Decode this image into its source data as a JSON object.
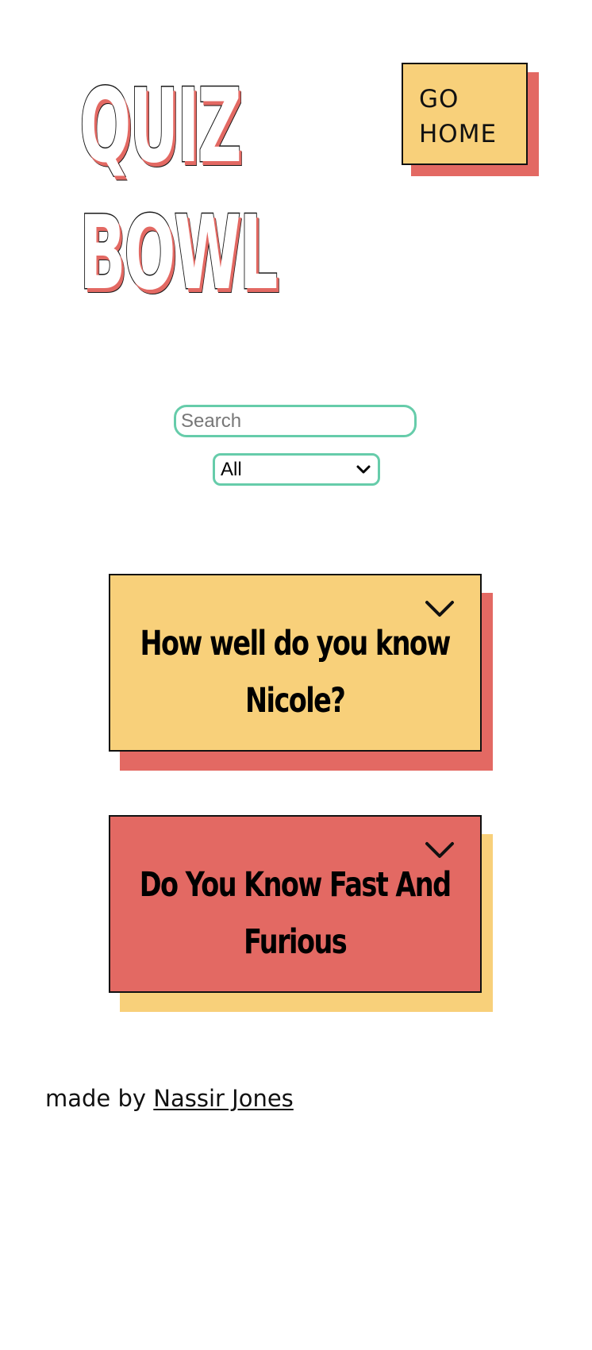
{
  "header": {
    "logo_lines": [
      "QUIZ",
      "BOWL"
    ],
    "home_button": {
      "line1": "GO",
      "line2": "HOME"
    }
  },
  "filters": {
    "search_placeholder": "Search",
    "search_value": "",
    "category_selected": "All"
  },
  "quizzes": [
    {
      "title": "How well do you know Nicole?",
      "card_color": "#f8d07a",
      "shadow_color": "#e36963"
    },
    {
      "title": "Do You Know Fast And Furious",
      "card_color": "#e36963",
      "shadow_color": "#f8d07a"
    }
  ],
  "footer": {
    "prefix": "made by",
    "author": "Nassir Jones"
  },
  "colors": {
    "accent_yellow": "#f8d07a",
    "accent_red": "#e36963",
    "input_border": "#66ccaa"
  },
  "icons": {
    "select_chevron": "chevron-down-icon",
    "card_chevron": "chevron-down-icon"
  }
}
